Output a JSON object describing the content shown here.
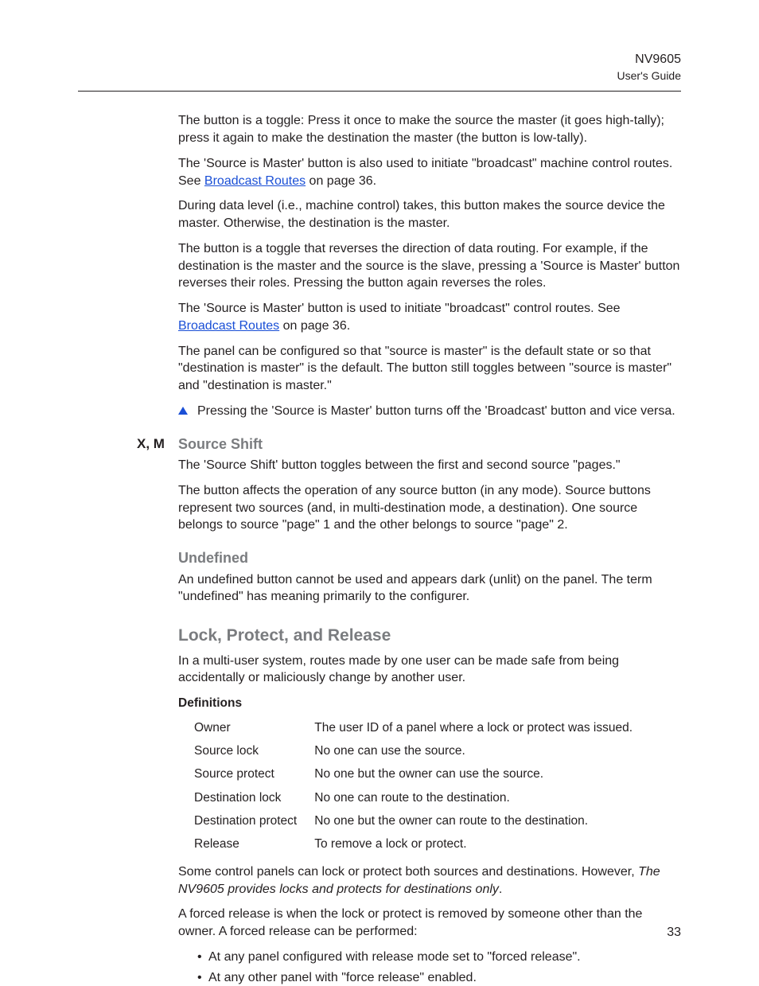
{
  "header": {
    "model": "NV9605",
    "guide": "User's Guide"
  },
  "intro": {
    "p1": "The button is a toggle: Press it once to make the source the master (it goes high-tally); press it again to make the destination the master (the button is low-tally).",
    "p2a": "The 'Source is Master' button is also used to initiate \"broadcast\" machine control routes. See ",
    "p2_link": "Broadcast Routes",
    "p2b": " on page 36.",
    "p3": "During data level (i.e., machine control) takes, this button makes the source device the master. Otherwise, the destination is the master.",
    "p4": "The button is a toggle that reverses the direction of data routing. For example, if the destination is the master and the source is the slave, pressing a 'Source is Master' button reverses their roles. Pressing the button again reverses the roles.",
    "p5a": "The 'Source is Master' button is used to initiate \"broadcast\" control routes. See ",
    "p5_link": "Broadcast Routes",
    "p5b": " on page 36.",
    "p6": "The panel can be configured so that \"source is master\" is the default state or so that \"destination is master\" is the default. The button still toggles between \"source is master\" and \"destination is master.\"",
    "note": "Pressing the 'Source is Master' button turns off the 'Broadcast' button and vice versa."
  },
  "sourceShift": {
    "tag": "X, M",
    "title": "Source Shift",
    "p1": "The 'Source Shift' button toggles between the first and second source \"pages.\"",
    "p2": "The button affects the operation of any source button (in any mode). Source buttons represent two sources (and, in multi-destination mode, a destination). One source belongs to source \"page\" 1 and the other belongs to source \"page\" 2."
  },
  "undefined": {
    "title": "Undefined",
    "p1": "An undefined button cannot be used and appears dark (unlit) on the panel. The term \"undefined\" has meaning primarily to the configurer."
  },
  "lpr": {
    "title": "Lock, Protect, and Release",
    "p1": "In a multi-user system, routes made by one user can be made safe from being accidentally or maliciously change by another user.",
    "defs_label": "Definitions",
    "defs": [
      {
        "term": "Owner",
        "desc": "The user ID of a panel where a lock or protect was issued."
      },
      {
        "term": "Source lock",
        "desc": "No one can use the source."
      },
      {
        "term": "Source protect",
        "desc": "No one but the owner can use the source."
      },
      {
        "term": "Destination lock",
        "desc": "No one can route to the destination."
      },
      {
        "term": "Destination protect",
        "desc": "No one but the owner can route to the destination."
      },
      {
        "term": "Release",
        "desc": "To remove a lock or protect."
      }
    ],
    "p2a": "Some control panels can lock or protect both sources and destinations. However, ",
    "p2_em": "The NV9605 provides locks and protects for destinations only",
    "p2b": ".",
    "p3": "A forced release is when the lock or protect is removed by someone other than the owner. A forced release can be performed:",
    "bullets": [
      "At any panel configured with release mode set to \"forced release\".",
      "At any other panel with \"force release\" enabled."
    ]
  },
  "pageNumber": "33"
}
